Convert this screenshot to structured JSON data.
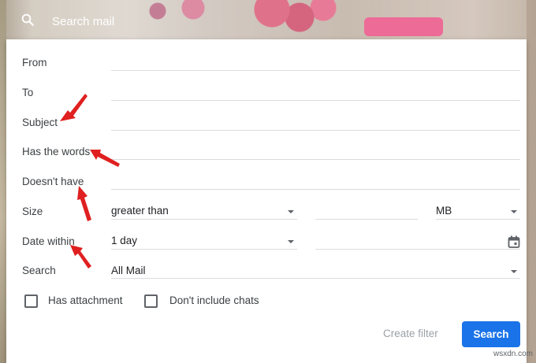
{
  "search_bar": {
    "placeholder": "Search mail"
  },
  "fields": {
    "from": {
      "label": "From",
      "value": ""
    },
    "to": {
      "label": "To",
      "value": ""
    },
    "subject": {
      "label": "Subject",
      "value": ""
    },
    "has_words": {
      "label": "Has the words",
      "value": ""
    },
    "doesnt_have": {
      "label": "Doesn't have",
      "value": ""
    },
    "size": {
      "label": "Size",
      "operator": "greater than",
      "value": "",
      "unit": "MB"
    },
    "date_within": {
      "label": "Date within",
      "range": "1 day",
      "value": ""
    },
    "search_in": {
      "label": "Search",
      "value": "All Mail"
    }
  },
  "options": {
    "has_attachment": {
      "label": "Has attachment",
      "checked": false
    },
    "dont_include_chats": {
      "label": "Don't include chats",
      "checked": false
    }
  },
  "actions": {
    "create_filter": "Create filter",
    "search": "Search"
  },
  "watermark": "wsxdn.com",
  "colors": {
    "primary": "#1a73e8",
    "annotation_arrow": "#e02020"
  },
  "icons": [
    "search-icon",
    "calendar-icon",
    "chevron-down-icon"
  ]
}
